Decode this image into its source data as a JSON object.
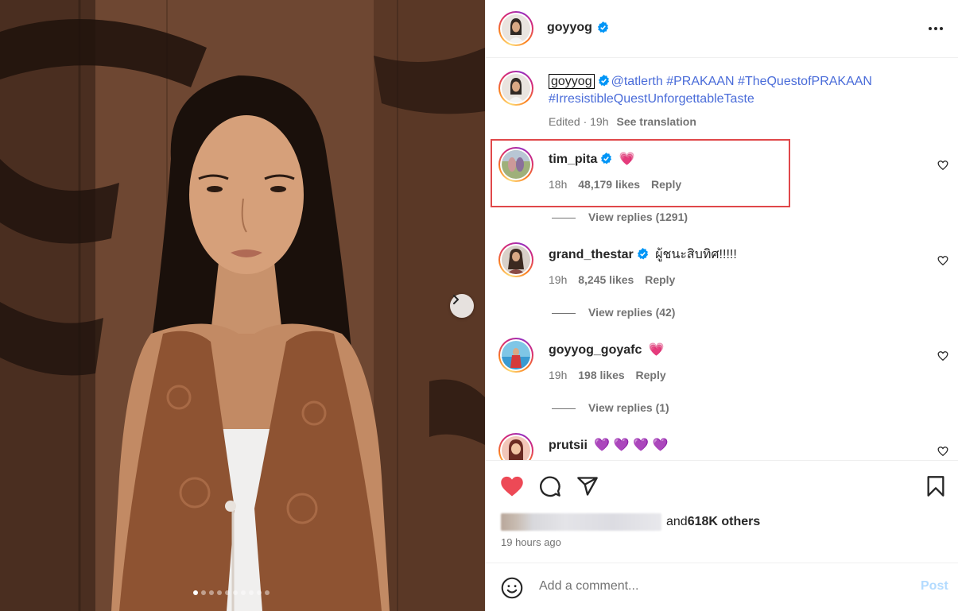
{
  "post": {
    "author": "goyyog",
    "caption": {
      "author": "goyyog",
      "mention": "@tatlerth",
      "hashtags_line1": "#PRAKAAN #TheQuestofPRAKAAN",
      "hashtags_line2": "#IrresistibleQuestUnforgettableTaste",
      "edited": "Edited · 19h",
      "see_translation": "See translation"
    },
    "carousel": {
      "total_slides": 10,
      "active_slide": 1
    }
  },
  "comments": [
    {
      "user": "tim_pita",
      "verified": true,
      "text": "💗",
      "time": "18h",
      "likes": "48,179 likes",
      "reply": "Reply",
      "view_replies": "View replies (1291)",
      "highlighted": true
    },
    {
      "user": "grand_thestar",
      "verified": true,
      "text": "ผู้ชนะสิบทิศ!!!!!",
      "time": "19h",
      "likes": "8,245 likes",
      "reply": "Reply",
      "view_replies": "View replies (42)"
    },
    {
      "user": "goyyog_goyafc",
      "verified": false,
      "text": "💗",
      "time": "19h",
      "likes": "198 likes",
      "reply": "Reply",
      "view_replies": "View replies (1)"
    },
    {
      "user": "prutsii",
      "verified": false,
      "text": "💜 💜 💜 💜"
    }
  ],
  "engagement": {
    "likes_suffix": " and ",
    "likes_count": "618K others",
    "posted": "19 hours ago"
  },
  "composer": {
    "placeholder": "Add a comment...",
    "post_label": "Post"
  },
  "colors": {
    "like_active": "#ed4956",
    "verified": "#0095f6",
    "link": "#4a6cd9",
    "post_disabled": "#b3dbff",
    "highlight": "#e0484a"
  }
}
